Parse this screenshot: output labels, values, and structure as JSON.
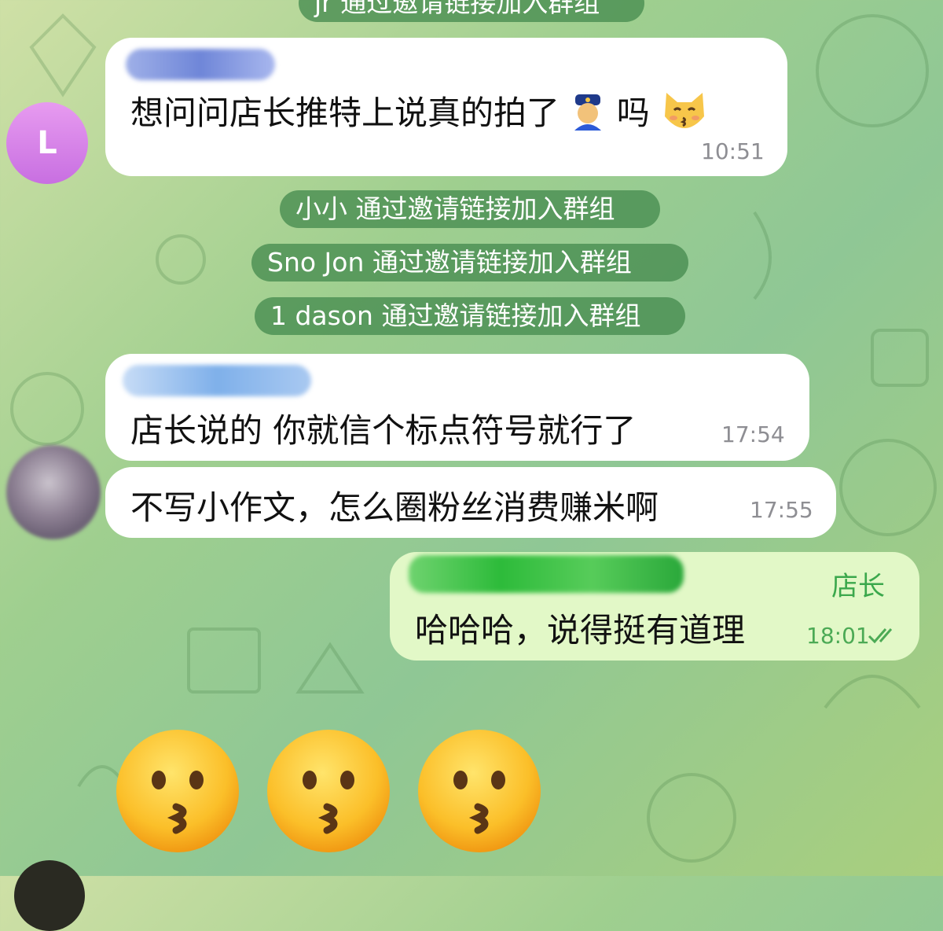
{
  "service_messages": [
    {
      "text": "jr 通过邀请链接加入群组"
    },
    {
      "text": "小小 通过邀请链接加入群组"
    },
    {
      "text": "Sno Jon 通过邀请链接加入群组"
    },
    {
      "text": "1 dason 通过邀请链接加入群组"
    }
  ],
  "messages": [
    {
      "text": "想问问店长推特上说真的拍了",
      "after_text": "吗",
      "time": "10:51",
      "emoji": [
        "police-officer-emoji",
        "kissing-cat-emoji"
      ]
    },
    {
      "text": "店长说的 你就信个标点符号就行了",
      "time": "17:54"
    },
    {
      "text": "不写小作文，怎么圈粉丝消费赚米啊",
      "time": "17:55"
    },
    {
      "sender": "店长",
      "text": "哈哈哈，说得挺有道理",
      "time": "18:01"
    }
  ],
  "avatars": {
    "first_letter": "L"
  },
  "emoji_row": [
    "kissing-face-emoji",
    "kissing-face-emoji",
    "kissing-face-emoji"
  ],
  "colors": {
    "service_pill": "#468c50",
    "incoming_bubble": "#ffffff",
    "outgoing_bubble": "#e2f8c7",
    "sender_name": "#3ba84c",
    "avatar_letter_bg": "#d17fe6"
  }
}
